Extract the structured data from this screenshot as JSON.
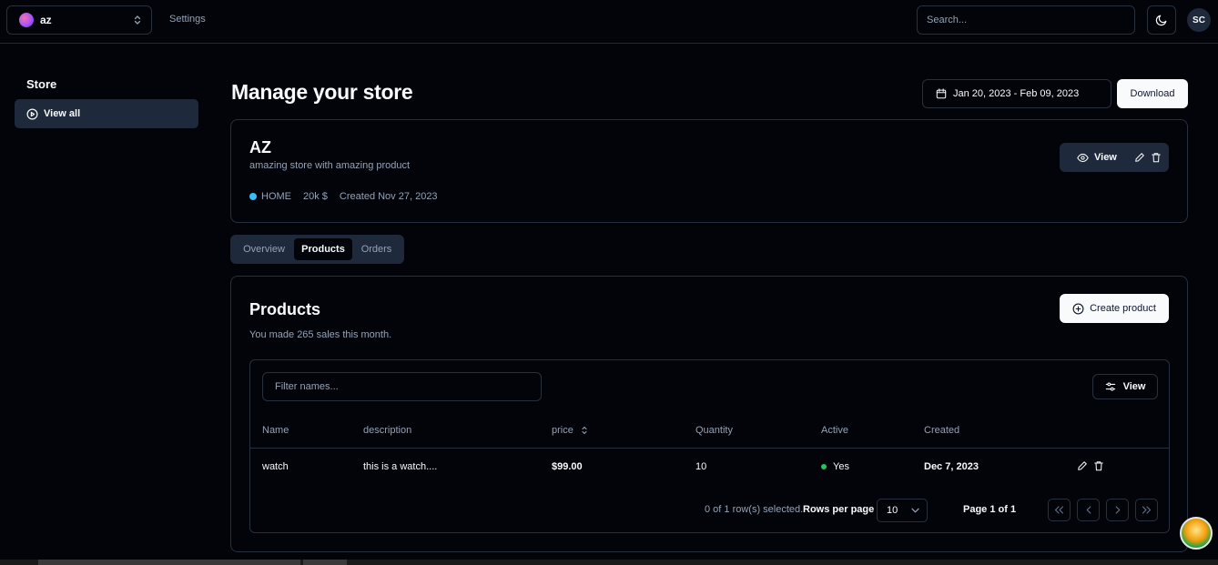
{
  "header": {
    "store_switcher": {
      "name": "az"
    },
    "nav": {
      "settings": "Settings"
    },
    "search": {
      "placeholder": "Search..."
    },
    "user": {
      "initials": "SC"
    }
  },
  "sidebar": {
    "title": "Store",
    "items": [
      {
        "label": "View all",
        "icon": "play-circle-icon"
      }
    ]
  },
  "main": {
    "title": "Manage your store",
    "date_range": "Jan 20, 2023 - Feb 09, 2023",
    "download_label": "Download"
  },
  "store_card": {
    "title": "AZ",
    "description": "amazing store with amazing product",
    "category": "HOME",
    "revenue": "20k $",
    "created": "Created Nov 27, 2023",
    "view_label": "View",
    "status_color": "#38bdf8"
  },
  "tabs": {
    "items": [
      {
        "label": "Overview"
      },
      {
        "label": "Products"
      },
      {
        "label": "Orders"
      }
    ],
    "active": "Products"
  },
  "products": {
    "title": "Products",
    "subtitle": "You made 265 sales this month.",
    "create_label": "Create product",
    "filter_placeholder": "Filter names...",
    "view_label": "View",
    "columns": [
      "Name",
      "description",
      "price",
      "Quantity",
      "Active",
      "Created"
    ],
    "rows": [
      {
        "name": "watch",
        "description": "this is a watch....",
        "price": "$99.00",
        "quantity": "10",
        "active": "Yes",
        "created": "Dec 7, 2023"
      }
    ],
    "footer": {
      "selected": "0 of 1 row(s) selected.",
      "rows_per_page_label": "Rows per page",
      "rows_per_page_value": "10",
      "page_label": "Page 1 of 1"
    }
  },
  "colors": {
    "background": "#020409",
    "border": "#27303f",
    "muted": "#94a3b8",
    "accent_active": "#22c55e",
    "category_dot": "#38bdf8"
  }
}
